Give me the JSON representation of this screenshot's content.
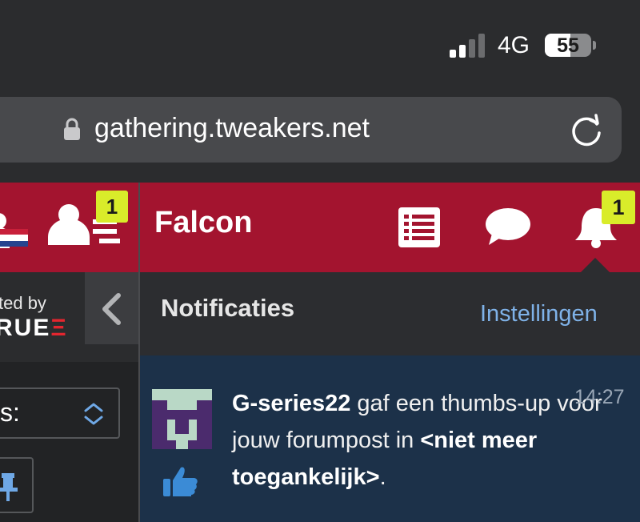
{
  "status_bar": {
    "network": "4G",
    "battery_percent": "55",
    "battery_level": 0.55
  },
  "browser": {
    "url": "gathering.tweakers.net"
  },
  "left_pane": {
    "badge_count": "1",
    "sponsor_prefix": "ted by",
    "sponsor_logo": "RUE",
    "select_label": "s:",
    "collapse_icon": "chevron-left-icon"
  },
  "header": {
    "title": "Falcon",
    "notification_count": "1"
  },
  "notifications": {
    "title": "Notificaties",
    "settings_link": "Instellingen",
    "items": [
      {
        "user": "G-series22",
        "text": " gaf een thumbs-up voor jouw forumpost in ",
        "target": "<niet meer toegankelijk>",
        "suffix": ".",
        "time": "14:27",
        "icon": "thumbs-up-icon"
      }
    ]
  },
  "colors": {
    "brand_red": "#a3142f",
    "badge_yellow": "#d9ec2a",
    "link_blue": "#7fb2e8",
    "notif_bg": "#1c3149"
  }
}
